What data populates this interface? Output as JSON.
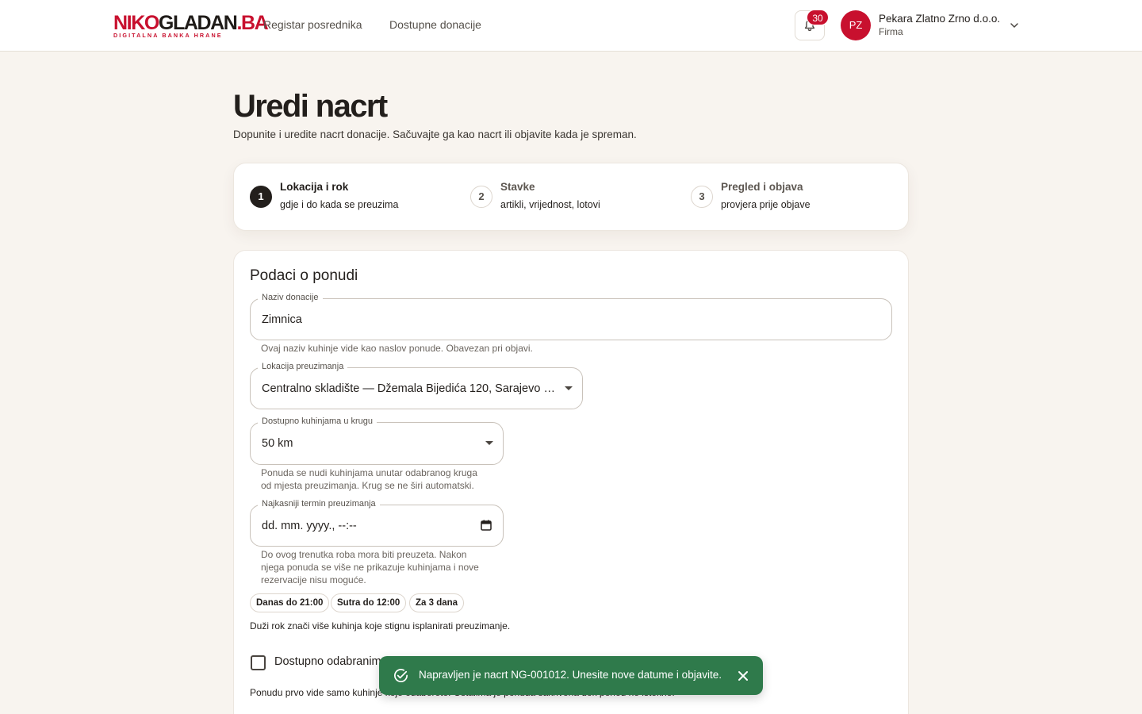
{
  "header": {
    "logo": {
      "part1": "NIKO",
      "part2": "GLADAN",
      "part3": ".BA",
      "tagline": "DIGITALNA BANKA HRANE"
    },
    "nav": [
      "Registar posrednika",
      "Dostupne donacije"
    ],
    "notifications_count": "30",
    "user": {
      "initials": "PZ",
      "name": "Pekara Zlatno Zrno d.o.o.",
      "role": "Firma"
    }
  },
  "page": {
    "title": "Uredi nacrt",
    "subtitle": "Dopunite i uredite nacrt donacije. Sačuvajte ga kao nacrt ili objavite kada je spreman."
  },
  "stepper": {
    "steps": [
      {
        "num": "1",
        "title": "Lokacija i rok",
        "desc": "gdje i do kada se preuzima",
        "active": true
      },
      {
        "num": "2",
        "title": "Stavke",
        "desc": "artikli, vrijednost, lotovi",
        "active": false
      },
      {
        "num": "3",
        "title": "Pregled i objava",
        "desc": "provjera prije objave",
        "active": false
      }
    ]
  },
  "form": {
    "section_title": "Podaci o ponudi",
    "name_field": {
      "label": "Naziv donacije",
      "value": "Zimnica",
      "helper": "Ovaj naziv kuhinje vide kao naslov ponude. Obavezan pri objavi."
    },
    "location_field": {
      "label": "Lokacija preuzimanja",
      "value": "Centralno skladište — Džemala Bijedića 120, Sarajevo (Z..."
    },
    "radius_field": {
      "label": "Dostupno kuhinjama u krugu",
      "value": "50 km",
      "helper_line1": "Ponuda se nudi kuhinjama unutar odabranog kruga",
      "helper_line2": "od mjesta preuzimanja. Krug se ne širi automatski."
    },
    "deadline_field": {
      "label": "Najkasniji termin preuzimanja",
      "placeholder": "dd. mm. yyyy., --:--",
      "helper_line1": "Do ovog trenutka roba mora biti preuzeta. Nakon",
      "helper_line2": "njega ponuda se više ne prikazuje kuhinjama i nove",
      "helper_line3": "rezervacije nisu moguće."
    },
    "quick_chips": [
      "Danas do 21:00",
      "Sutra do 12:00",
      "Za 3 dana"
    ],
    "chips_note": "Duži rok znači više kuhinja koje stignu isplanirati preuzimanje.",
    "checkbox_label": "Dostupno odabranim",
    "checkbox_note": "Ponudu prvo vide samo kuhinje koje odaberete. Ostalima je ponuda sakrivena dok period ne istekne."
  },
  "toast": {
    "message": "Napravljen je nacrt NG-001012. Unesite nove datume i objavite."
  },
  "colors": {
    "brand_red": "#c8102e",
    "success_green": "#2f7a4b",
    "page_bg": "#f8f4ef",
    "text_dark": "#231f1c"
  }
}
